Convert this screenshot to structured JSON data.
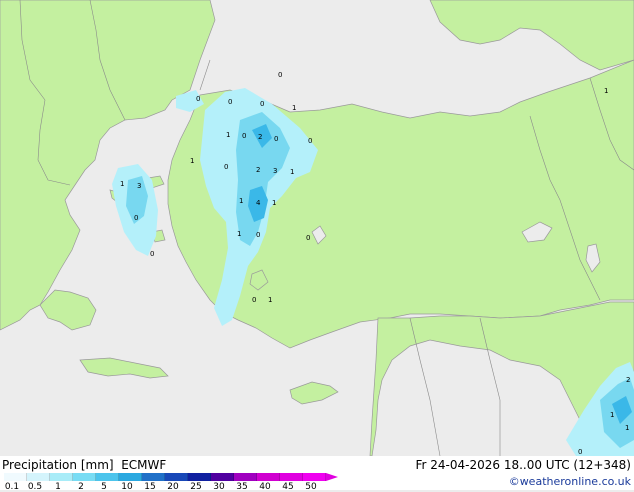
{
  "title": "Precipitation [mm]  ECMWF",
  "datetime": "Fr 24-04-2026 18..00 UTC (12+348)",
  "credit": "©weatheronline.co.uk",
  "colors": {
    "sea": "#ececec",
    "land": "#c4f0a0",
    "border": "#9a9a9a",
    "precip_light": "#b4f0fa",
    "precip_mid": "#78d8f0",
    "precip_heavy": "#3ab8e8"
  },
  "legend": {
    "ticks": [
      "0.1",
      "0.5",
      "1",
      "2",
      "5",
      "10",
      "15",
      "20",
      "25",
      "30",
      "35",
      "40",
      "45",
      "50"
    ],
    "colors": [
      "#f0fafe",
      "#d4f4fc",
      "#a8ecf8",
      "#78dcf4",
      "#4cc4ec",
      "#2aa8e0",
      "#2070c8",
      "#1848b8",
      "#1020a0",
      "#5000a0",
      "#a000c0",
      "#d000d0",
      "#e000e0",
      "#f000f0"
    ]
  },
  "values": [
    "0",
    "0",
    "1",
    "1",
    "0",
    "1",
    "0",
    "0",
    "1",
    "0",
    "0",
    "0",
    "1",
    "2",
    "2",
    "3",
    "1",
    "3",
    "1",
    "4",
    "1",
    "1",
    "0",
    "0",
    "0",
    "0",
    "1",
    "1",
    "2",
    "1",
    "0",
    "0"
  ]
}
